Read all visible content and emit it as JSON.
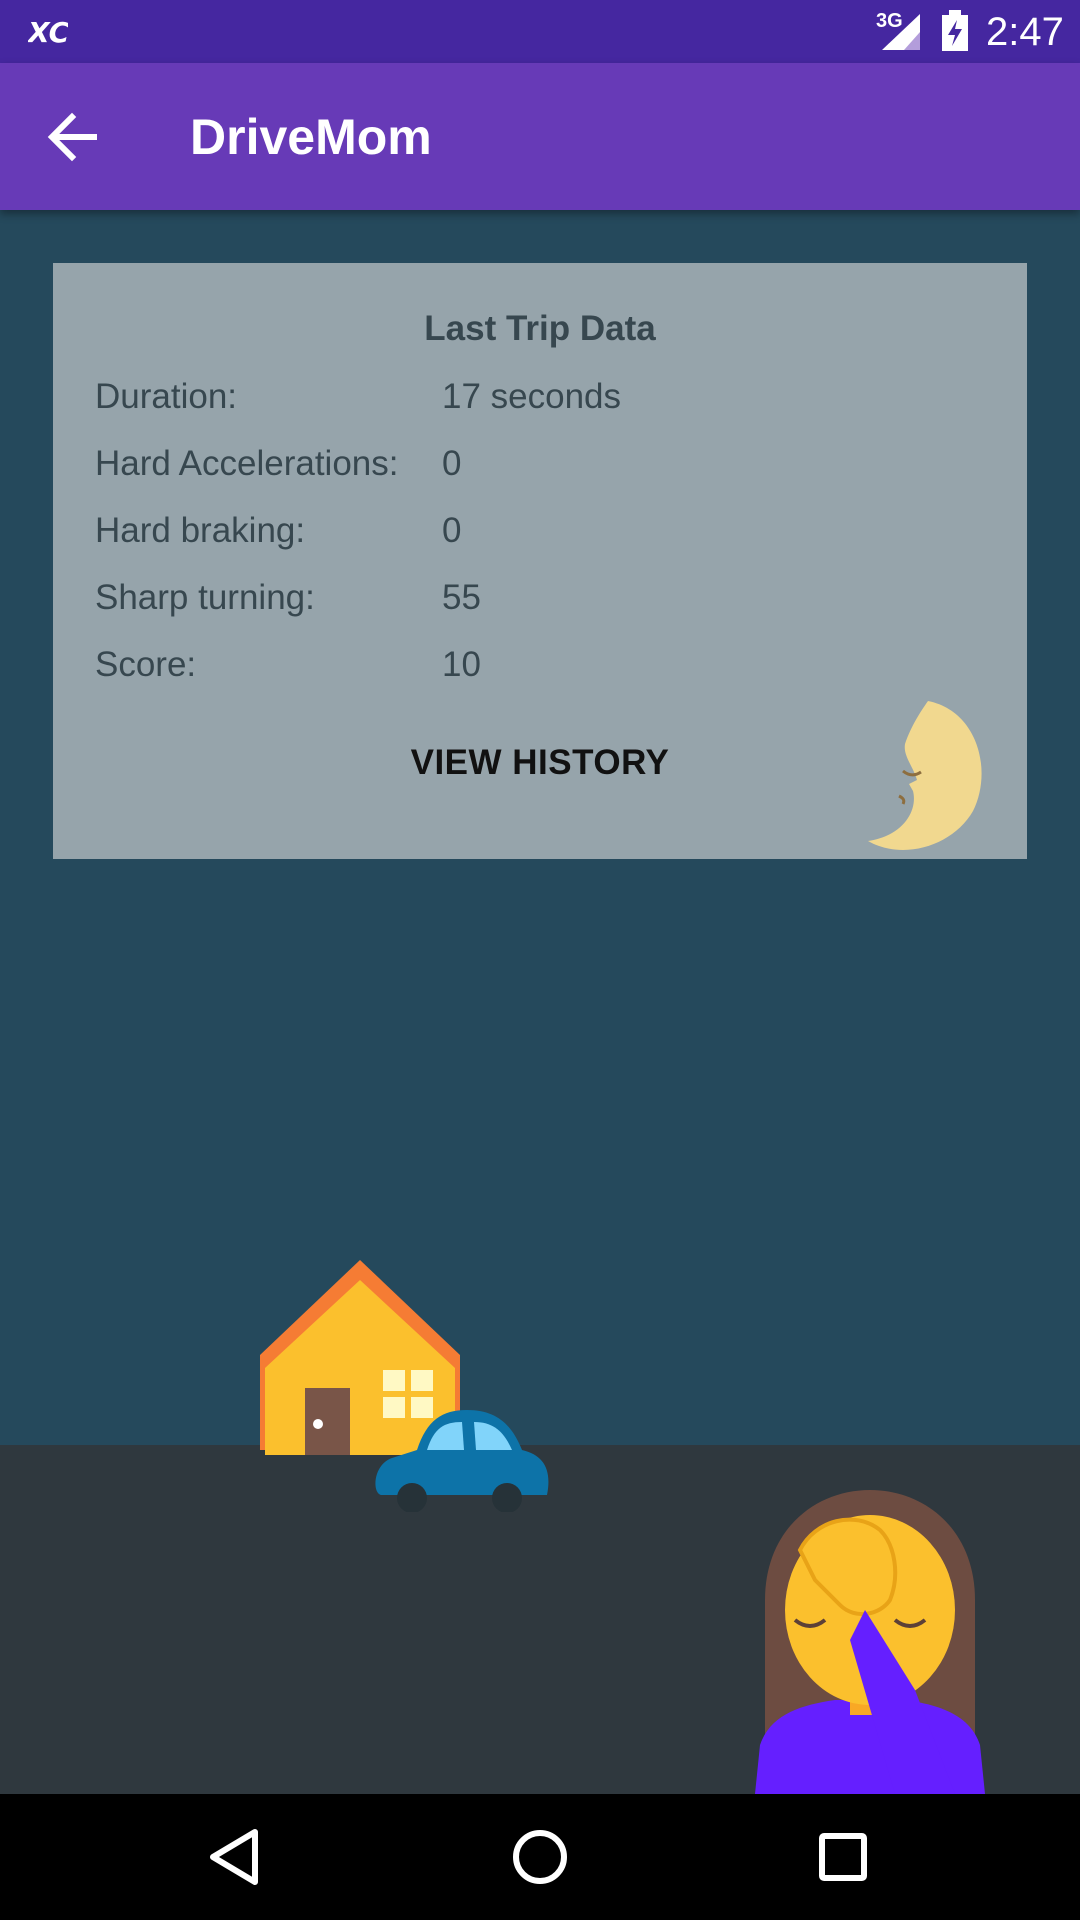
{
  "status_bar": {
    "network": "3G",
    "time": "2:47",
    "notification_icon": "xc-app-icon",
    "signal_icon": "signal-icon",
    "battery_icon": "battery-charging-icon"
  },
  "app_bar": {
    "title": "DriveMom",
    "back_icon": "arrow-back-icon"
  },
  "card": {
    "title": "Last Trip Data",
    "rows": [
      {
        "label": "Duration:",
        "value": "17 seconds"
      },
      {
        "label": "Hard Accelerations:",
        "value": "0"
      },
      {
        "label": "Hard braking:",
        "value": "0"
      },
      {
        "label": "Sharp turning:",
        "value": "55"
      },
      {
        "label": "Score:",
        "value": "10"
      }
    ],
    "button_label": "VIEW HISTORY",
    "decoration_icon": "crescent-moon-face-icon"
  },
  "scene": {
    "icons": [
      "house-icon",
      "car-icon",
      "person-facepalming-icon"
    ]
  },
  "colors": {
    "status_bar": "#4527a0",
    "app_bar": "#673ab7",
    "background": "#25495c",
    "ground": "#2f383e",
    "card": "#96a4ab"
  },
  "nav_bar": {
    "icons": [
      "back-triangle-icon",
      "home-circle-icon",
      "recents-square-icon"
    ]
  }
}
